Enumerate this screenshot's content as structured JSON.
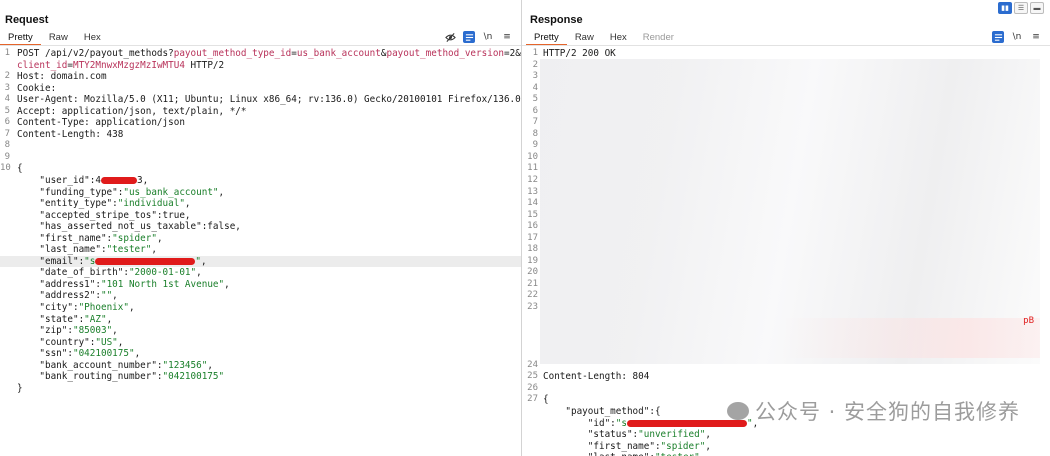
{
  "request": {
    "title": "Request",
    "tabs": [
      {
        "label": "Pretty",
        "active": true
      },
      {
        "label": "Raw"
      },
      {
        "label": "Hex"
      }
    ],
    "icons": [
      "eye-off-icon",
      "wrap-icon",
      "newline-icon",
      "menu-icon"
    ],
    "newline_label": "\\n",
    "lines": [
      {
        "n": "1",
        "parts": [
          [
            "k",
            "POST /api/v2/payout_methods?"
          ],
          [
            "p",
            "payout_method_type_id"
          ],
          [
            "k",
            "="
          ],
          [
            "p",
            "us_bank_account"
          ],
          [
            "k",
            "&"
          ],
          [
            "p",
            "payout_method_version"
          ],
          [
            "k",
            "=2&"
          ]
        ]
      },
      {
        "n": "",
        "parts": [
          [
            "p",
            "client_id"
          ],
          [
            "k",
            "="
          ],
          [
            "p",
            "MTY2MnwxMzgzMzIwMTU4"
          ],
          [
            "k",
            " HTTP/2"
          ]
        ]
      },
      {
        "n": "2",
        "parts": [
          [
            "k",
            "Host: domain.com"
          ]
        ]
      },
      {
        "n": "3",
        "parts": [
          [
            "k",
            "Cookie:"
          ]
        ]
      },
      {
        "n": "4",
        "parts": [
          [
            "k",
            "User-Agent: Mozilla/5.0 (X11; Ubuntu; Linux x86_64; rv:136.0) Gecko/20100101 Firefox/136.0"
          ]
        ]
      },
      {
        "n": "5",
        "parts": [
          [
            "k",
            "Accept: application/json, text/plain, */*"
          ]
        ]
      },
      {
        "n": "6",
        "parts": [
          [
            "k",
            "Content-Type: application/json"
          ]
        ]
      },
      {
        "n": "7",
        "parts": [
          [
            "k",
            "Content-Length: 438"
          ]
        ]
      },
      {
        "n": "8",
        "parts": []
      },
      {
        "n": "9",
        "parts": []
      },
      {
        "n": "10",
        "parts": [
          [
            "k",
            "{"
          ]
        ]
      },
      {
        "n": "",
        "parts": [
          [
            "k",
            "    \"user_id\":4"
          ],
          [
            "r",
            "36"
          ],
          [
            "n",
            "3,"
          ]
        ]
      },
      {
        "n": "",
        "parts": [
          [
            "k",
            "    \"funding_type\":"
          ],
          [
            "s",
            "\"us_bank_account\""
          ],
          [
            "k",
            ","
          ]
        ]
      },
      {
        "n": "",
        "parts": [
          [
            "k",
            "    \"entity_type\":"
          ],
          [
            "s",
            "\"individual\""
          ],
          [
            "k",
            ","
          ]
        ]
      },
      {
        "n": "",
        "parts": [
          [
            "k",
            "    \"accepted_stripe_tos\":true,"
          ]
        ]
      },
      {
        "n": "",
        "parts": [
          [
            "k",
            "    \"has_asserted_not_us_taxable\":false,"
          ]
        ]
      },
      {
        "n": "",
        "parts": [
          [
            "k",
            "    \"first_name\":"
          ],
          [
            "s",
            "\"spider\""
          ],
          [
            "k",
            ","
          ]
        ]
      },
      {
        "n": "",
        "parts": [
          [
            "k",
            "    \"last_name\":"
          ],
          [
            "s",
            "\"tester\""
          ],
          [
            "k",
            ","
          ]
        ]
      },
      {
        "n": "",
        "hl": true,
        "parts": [
          [
            "k",
            "    \"email\":"
          ],
          [
            "s",
            "\"s"
          ],
          [
            "r",
            "100"
          ],
          [
            "s",
            "\""
          ],
          [
            "k",
            ","
          ]
        ]
      },
      {
        "n": "",
        "parts": [
          [
            "k",
            "    \"date_of_birth\":"
          ],
          [
            "s",
            "\"2000-01-01\""
          ],
          [
            "k",
            ","
          ]
        ]
      },
      {
        "n": "",
        "parts": [
          [
            "k",
            "    \"address1\":"
          ],
          [
            "s",
            "\"101 North 1st Avenue\""
          ],
          [
            "k",
            ","
          ]
        ]
      },
      {
        "n": "",
        "parts": [
          [
            "k",
            "    \"address2\":"
          ],
          [
            "s",
            "\"\""
          ],
          [
            "k",
            ","
          ]
        ]
      },
      {
        "n": "",
        "parts": [
          [
            "k",
            "    \"city\":"
          ],
          [
            "s",
            "\"Phoenix\""
          ],
          [
            "k",
            ","
          ]
        ]
      },
      {
        "n": "",
        "parts": [
          [
            "k",
            "    \"state\":"
          ],
          [
            "s",
            "\"AZ\""
          ],
          [
            "k",
            ","
          ]
        ]
      },
      {
        "n": "",
        "parts": [
          [
            "k",
            "    \"zip\":"
          ],
          [
            "s",
            "\"85003\""
          ],
          [
            "k",
            ","
          ]
        ]
      },
      {
        "n": "",
        "parts": [
          [
            "k",
            "    \"country\":"
          ],
          [
            "s",
            "\"US\""
          ],
          [
            "k",
            ","
          ]
        ]
      },
      {
        "n": "",
        "parts": [
          [
            "k",
            "    \"ssn\":"
          ],
          [
            "s",
            "\"042100175\""
          ],
          [
            "k",
            ","
          ]
        ]
      },
      {
        "n": "",
        "parts": [
          [
            "k",
            "    \"bank_account_number\":"
          ],
          [
            "s",
            "\"123456\""
          ],
          [
            "k",
            ","
          ]
        ]
      },
      {
        "n": "",
        "parts": [
          [
            "k",
            "    \"bank_routing_number\":"
          ],
          [
            "s",
            "\"042100175\""
          ]
        ]
      },
      {
        "n": "",
        "parts": [
          [
            "k",
            "}"
          ]
        ]
      }
    ]
  },
  "response": {
    "title": "Response",
    "tabs": [
      {
        "label": "Pretty",
        "active": true
      },
      {
        "label": "Raw"
      },
      {
        "label": "Hex"
      },
      {
        "label": "Render",
        "disabled": true
      }
    ],
    "icons": [
      "wrap-icon",
      "newline-icon",
      "menu-icon"
    ],
    "newline_label": "\\n",
    "blurred_fragment": "pB",
    "lines": [
      {
        "n": "1",
        "parts": [
          [
            "k",
            "HTTP/2 200 OK"
          ]
        ]
      },
      {
        "n": "2",
        "parts": []
      },
      {
        "n": "3",
        "parts": []
      },
      {
        "n": "4",
        "parts": []
      },
      {
        "n": "5",
        "parts": []
      },
      {
        "n": "6",
        "parts": []
      },
      {
        "n": "7",
        "parts": []
      },
      {
        "n": "8",
        "parts": []
      },
      {
        "n": "9",
        "parts": []
      },
      {
        "n": "10",
        "parts": []
      },
      {
        "n": "11",
        "parts": []
      },
      {
        "n": "12",
        "parts": []
      },
      {
        "n": "13",
        "parts": []
      },
      {
        "n": "14",
        "parts": []
      },
      {
        "n": "15",
        "parts": []
      },
      {
        "n": "16",
        "parts": []
      },
      {
        "n": "17",
        "parts": []
      },
      {
        "n": "18",
        "parts": []
      },
      {
        "n": "19",
        "parts": []
      },
      {
        "n": "20",
        "parts": []
      },
      {
        "n": "21",
        "parts": []
      },
      {
        "n": "22",
        "parts": []
      },
      {
        "n": "23",
        "parts": []
      },
      {
        "n": "",
        "parts": []
      },
      {
        "n": "",
        "parts": []
      },
      {
        "n": "",
        "parts": []
      },
      {
        "n": "",
        "parts": []
      },
      {
        "n": "24",
        "parts": []
      },
      {
        "n": "25",
        "parts": [
          [
            "k",
            "Content-Length: 804"
          ]
        ]
      },
      {
        "n": "26",
        "parts": []
      },
      {
        "n": "27",
        "parts": [
          [
            "k",
            "{"
          ]
        ]
      },
      {
        "n": "",
        "parts": [
          [
            "k",
            "    \"payout_method\":{"
          ]
        ]
      },
      {
        "n": "",
        "parts": [
          [
            "k",
            "        \"id\":"
          ],
          [
            "s",
            "\"s"
          ],
          [
            "r",
            "120"
          ],
          [
            "s",
            "\""
          ],
          [
            "k",
            ","
          ]
        ]
      },
      {
        "n": "",
        "parts": [
          [
            "k",
            "        \"status\":"
          ],
          [
            "s",
            "\"unverified\""
          ],
          [
            "k",
            ","
          ]
        ]
      },
      {
        "n": "",
        "parts": [
          [
            "k",
            "        \"first_name\":"
          ],
          [
            "s",
            "\"spider\""
          ],
          [
            "k",
            ","
          ]
        ]
      },
      {
        "n": "",
        "parts": [
          [
            "k",
            "        \"last_name\":"
          ],
          [
            "s",
            "\"tester\""
          ],
          [
            "k",
            ","
          ]
        ]
      }
    ]
  },
  "watermark": "公众号 · 安全狗的自我修养",
  "layout_buttons": [
    "split-horizontal",
    "split-vertical",
    "single"
  ]
}
